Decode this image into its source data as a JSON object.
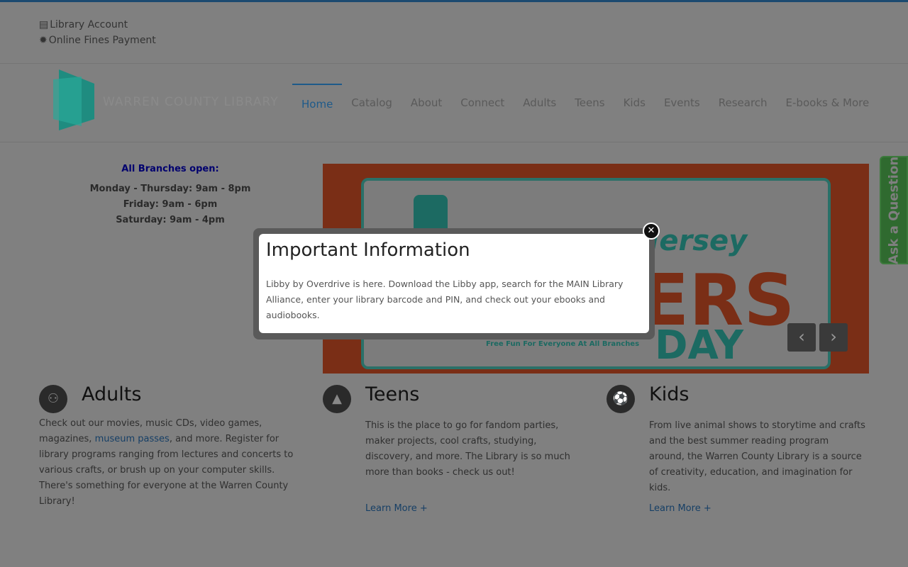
{
  "utility_links": [
    {
      "label": "Library Account",
      "icon": "id-card-icon"
    },
    {
      "label": "Online Fines Payment",
      "icon": "gear-icon"
    }
  ],
  "logo_text": "WARREN COUNTY LIBRARY",
  "nav": [
    {
      "label": "Home",
      "active": true
    },
    {
      "label": "Catalog"
    },
    {
      "label": "About"
    },
    {
      "label": "Connect"
    },
    {
      "label": "Adults"
    },
    {
      "label": "Teens"
    },
    {
      "label": "Kids"
    },
    {
      "label": "Events"
    },
    {
      "label": "Research"
    },
    {
      "label": "E-books & More"
    }
  ],
  "hours": {
    "heading": "All Branches open:",
    "lines": [
      "Monday - Thursday: 9am - 8pm",
      "Friday: 9am - 6pm",
      "Saturday: 9am - 4pm"
    ]
  },
  "banner": {
    "line1": "New Jersey",
    "line2": "ERS",
    "line3": "DAY",
    "tagline": "Free Fun For Everyone At All Branches"
  },
  "ask_tab": "Ask a Question",
  "sections": [
    {
      "title": "Adults",
      "icon": "users-icon",
      "text_before": "Check out our movies, music CDs, video games, magazines, ",
      "link": "museum passes",
      "text_after": ", and more.  Register for library programs ranging from lectures and concerts to various crafts, or brush up on your computer skills. There's something for everyone at the Warren County Library!"
    },
    {
      "title": "Teens",
      "icon": "graduation-cap-icon",
      "text": "This is the place to go for fandom parties, maker projects, cool crafts, studying, discovery, and more. The Library is so much more than books - check us out!",
      "more": "Learn More +"
    },
    {
      "title": "Kids",
      "icon": "basketball-icon",
      "text": "From live animal shows to storytime and crafts and the best summer reading program around, the Warren County Library is a source of creativity, education, and imagination for kids.",
      "more": "Learn More +"
    }
  ],
  "modal": {
    "title": "Important Information",
    "body": "Libby by Overdrive is here. Download the Libby app, search for the MAIN Library Alliance, enter your library barcode and PIN, and check out your ebooks and audiobooks."
  }
}
